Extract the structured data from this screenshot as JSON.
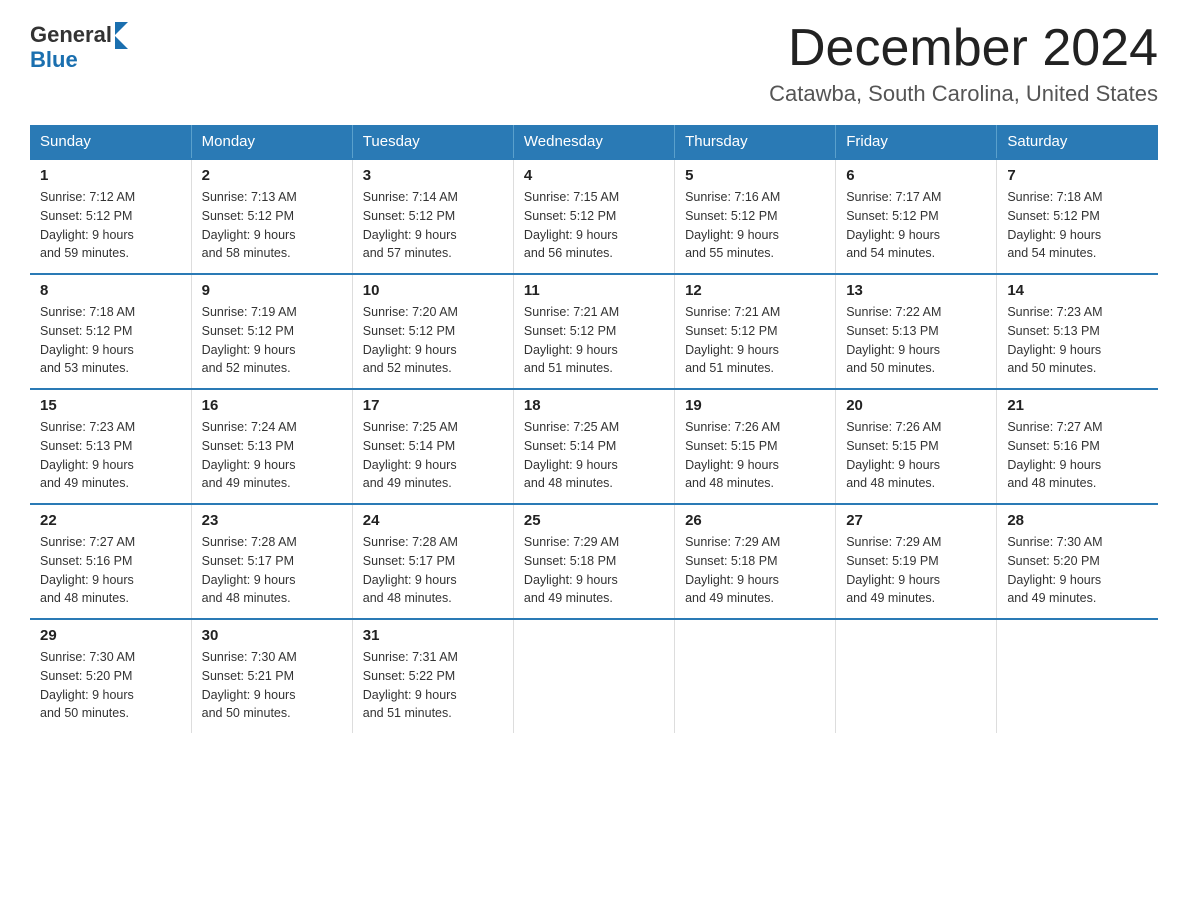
{
  "header": {
    "logo_general": "General",
    "logo_blue": "Blue",
    "title": "December 2024",
    "subtitle": "Catawba, South Carolina, United States"
  },
  "weekdays": [
    "Sunday",
    "Monday",
    "Tuesday",
    "Wednesday",
    "Thursday",
    "Friday",
    "Saturday"
  ],
  "weeks": [
    [
      {
        "day": "1",
        "sunrise": "7:12 AM",
        "sunset": "5:12 PM",
        "daylight": "9 hours and 59 minutes."
      },
      {
        "day": "2",
        "sunrise": "7:13 AM",
        "sunset": "5:12 PM",
        "daylight": "9 hours and 58 minutes."
      },
      {
        "day": "3",
        "sunrise": "7:14 AM",
        "sunset": "5:12 PM",
        "daylight": "9 hours and 57 minutes."
      },
      {
        "day": "4",
        "sunrise": "7:15 AM",
        "sunset": "5:12 PM",
        "daylight": "9 hours and 56 minutes."
      },
      {
        "day": "5",
        "sunrise": "7:16 AM",
        "sunset": "5:12 PM",
        "daylight": "9 hours and 55 minutes."
      },
      {
        "day": "6",
        "sunrise": "7:17 AM",
        "sunset": "5:12 PM",
        "daylight": "9 hours and 54 minutes."
      },
      {
        "day": "7",
        "sunrise": "7:18 AM",
        "sunset": "5:12 PM",
        "daylight": "9 hours and 54 minutes."
      }
    ],
    [
      {
        "day": "8",
        "sunrise": "7:18 AM",
        "sunset": "5:12 PM",
        "daylight": "9 hours and 53 minutes."
      },
      {
        "day": "9",
        "sunrise": "7:19 AM",
        "sunset": "5:12 PM",
        "daylight": "9 hours and 52 minutes."
      },
      {
        "day": "10",
        "sunrise": "7:20 AM",
        "sunset": "5:12 PM",
        "daylight": "9 hours and 52 minutes."
      },
      {
        "day": "11",
        "sunrise": "7:21 AM",
        "sunset": "5:12 PM",
        "daylight": "9 hours and 51 minutes."
      },
      {
        "day": "12",
        "sunrise": "7:21 AM",
        "sunset": "5:12 PM",
        "daylight": "9 hours and 51 minutes."
      },
      {
        "day": "13",
        "sunrise": "7:22 AM",
        "sunset": "5:13 PM",
        "daylight": "9 hours and 50 minutes."
      },
      {
        "day": "14",
        "sunrise": "7:23 AM",
        "sunset": "5:13 PM",
        "daylight": "9 hours and 50 minutes."
      }
    ],
    [
      {
        "day": "15",
        "sunrise": "7:23 AM",
        "sunset": "5:13 PM",
        "daylight": "9 hours and 49 minutes."
      },
      {
        "day": "16",
        "sunrise": "7:24 AM",
        "sunset": "5:13 PM",
        "daylight": "9 hours and 49 minutes."
      },
      {
        "day": "17",
        "sunrise": "7:25 AM",
        "sunset": "5:14 PM",
        "daylight": "9 hours and 49 minutes."
      },
      {
        "day": "18",
        "sunrise": "7:25 AM",
        "sunset": "5:14 PM",
        "daylight": "9 hours and 48 minutes."
      },
      {
        "day": "19",
        "sunrise": "7:26 AM",
        "sunset": "5:15 PM",
        "daylight": "9 hours and 48 minutes."
      },
      {
        "day": "20",
        "sunrise": "7:26 AM",
        "sunset": "5:15 PM",
        "daylight": "9 hours and 48 minutes."
      },
      {
        "day": "21",
        "sunrise": "7:27 AM",
        "sunset": "5:16 PM",
        "daylight": "9 hours and 48 minutes."
      }
    ],
    [
      {
        "day": "22",
        "sunrise": "7:27 AM",
        "sunset": "5:16 PM",
        "daylight": "9 hours and 48 minutes."
      },
      {
        "day": "23",
        "sunrise": "7:28 AM",
        "sunset": "5:17 PM",
        "daylight": "9 hours and 48 minutes."
      },
      {
        "day": "24",
        "sunrise": "7:28 AM",
        "sunset": "5:17 PM",
        "daylight": "9 hours and 48 minutes."
      },
      {
        "day": "25",
        "sunrise": "7:29 AM",
        "sunset": "5:18 PM",
        "daylight": "9 hours and 49 minutes."
      },
      {
        "day": "26",
        "sunrise": "7:29 AM",
        "sunset": "5:18 PM",
        "daylight": "9 hours and 49 minutes."
      },
      {
        "day": "27",
        "sunrise": "7:29 AM",
        "sunset": "5:19 PM",
        "daylight": "9 hours and 49 minutes."
      },
      {
        "day": "28",
        "sunrise": "7:30 AM",
        "sunset": "5:20 PM",
        "daylight": "9 hours and 49 minutes."
      }
    ],
    [
      {
        "day": "29",
        "sunrise": "7:30 AM",
        "sunset": "5:20 PM",
        "daylight": "9 hours and 50 minutes."
      },
      {
        "day": "30",
        "sunrise": "7:30 AM",
        "sunset": "5:21 PM",
        "daylight": "9 hours and 50 minutes."
      },
      {
        "day": "31",
        "sunrise": "7:31 AM",
        "sunset": "5:22 PM",
        "daylight": "9 hours and 51 minutes."
      },
      null,
      null,
      null,
      null
    ]
  ],
  "labels": {
    "sunrise": "Sunrise:",
    "sunset": "Sunset:",
    "daylight": "Daylight:"
  }
}
